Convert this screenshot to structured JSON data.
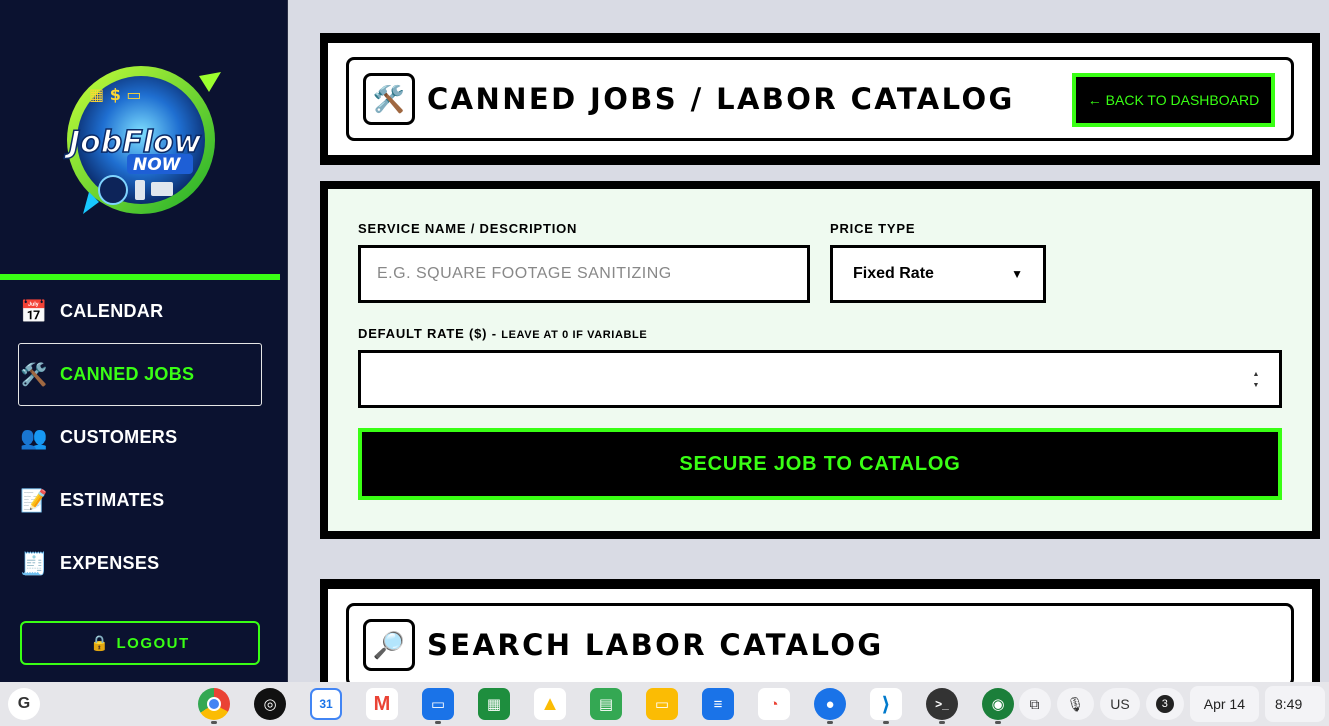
{
  "sidebar": {
    "logo_text": "JobFlow NOW",
    "items": [
      {
        "label": "CALENDAR",
        "icon": "calendar-icon"
      },
      {
        "label": "CANNED JOBS",
        "icon": "tools-icon"
      },
      {
        "label": "CUSTOMERS",
        "icon": "people-icon"
      },
      {
        "label": "ESTIMATES",
        "icon": "memo-icon"
      },
      {
        "label": "EXPENSES",
        "icon": "receipt-icon"
      }
    ],
    "logout_label": "LOGOUT"
  },
  "header": {
    "title": "CANNED JOBS / LABOR CATALOG",
    "back_label": "← BACK TO DASHBOARD"
  },
  "form": {
    "service_label": "SERVICE NAME / DESCRIPTION",
    "service_placeholder": "E.G. SQUARE FOOTAGE SANITIZING",
    "price_type_label": "PRICE TYPE",
    "price_type_value": "Fixed Rate",
    "rate_label": "DEFAULT RATE ($) -",
    "rate_hint": "LEAVE AT 0 IF VARIABLE",
    "rate_value": "",
    "submit_label": "SECURE JOB TO CATALOG"
  },
  "search": {
    "title": "SEARCH LABOR CATALOG"
  },
  "taskbar": {
    "launcher": "G",
    "apps": [
      {
        "name": "chrome-icon",
        "color": "#ffffff"
      },
      {
        "name": "podcast-icon",
        "color": "#111111"
      },
      {
        "name": "google-calendar-icon",
        "color": "#ffffff"
      },
      {
        "name": "gmail-icon",
        "color": "#ffffff"
      },
      {
        "name": "files-icon",
        "color": "#1a73e8"
      },
      {
        "name": "sheets-icon",
        "color": "#1e8e3e"
      },
      {
        "name": "drive-icon",
        "color": "#ffffff"
      },
      {
        "name": "sheets-alt-icon",
        "color": "#34a853"
      },
      {
        "name": "slides-icon",
        "color": "#fbbc04"
      },
      {
        "name": "docs-icon",
        "color": "#1a73e8"
      },
      {
        "name": "chrome-web-store-icon",
        "color": "#ffffff"
      },
      {
        "name": "messages-icon",
        "color": "#1a73e8"
      },
      {
        "name": "vscode-icon",
        "color": "#ffffff"
      },
      {
        "name": "terminal-icon",
        "color": "#333333"
      },
      {
        "name": "earth-app-icon",
        "color": "#ffffff"
      }
    ],
    "keyboard_layout": "US",
    "notifications": "3",
    "date": "Apr 14",
    "time": "8:49"
  },
  "colors": {
    "accent": "#39ff14",
    "sidebar_bg": "#0b1230",
    "form_bg": "#effaf0"
  }
}
